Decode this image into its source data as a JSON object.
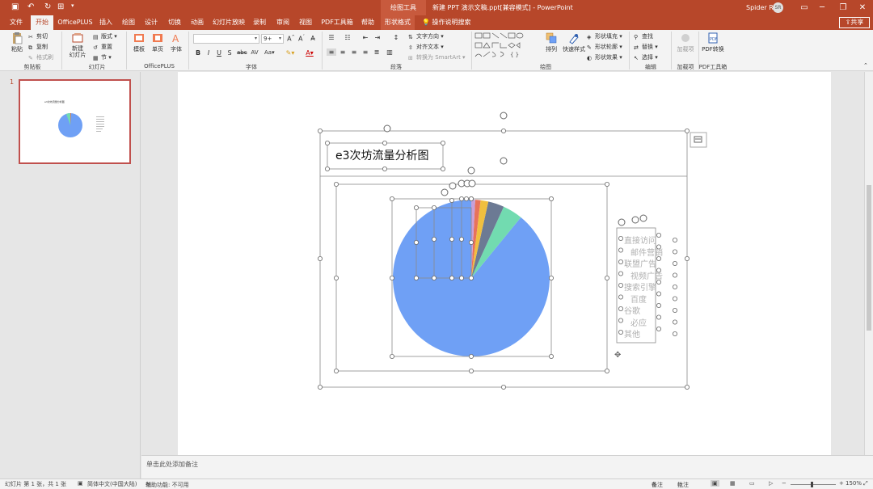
{
  "titlebar": {
    "context_label": "绘图工具",
    "doc_title": "新建 PPT 演示文稿.ppt[兼容模式] - PowerPoint",
    "user": "Spider R",
    "avatar": "SR",
    "qat_icons": [
      "save-icon",
      "undo-icon",
      "redo-icon",
      "slideshow-icon"
    ],
    "window_icons": [
      "ribbon-options-icon",
      "minimize-icon",
      "restore-icon",
      "close-icon"
    ]
  },
  "tabs": [
    {
      "label": "文件"
    },
    {
      "label": "开始"
    },
    {
      "label": "OfficePLUS"
    },
    {
      "label": "插入"
    },
    {
      "label": "绘图"
    },
    {
      "label": "设计"
    },
    {
      "label": "切换"
    },
    {
      "label": "动画"
    },
    {
      "label": "幻灯片放映"
    },
    {
      "label": "录制"
    },
    {
      "label": "审阅"
    },
    {
      "label": "视图"
    },
    {
      "label": "PDF工具箱"
    },
    {
      "label": "帮助"
    },
    {
      "label": "形状格式"
    }
  ],
  "active_tab": "开始",
  "tellme": "操作说明搜索",
  "share": "共享",
  "ribbon": {
    "clipboard": {
      "paste": "粘贴",
      "cut": "剪切",
      "copy": "复制",
      "format_painter": "格式刷",
      "label": "剪贴板"
    },
    "slides": {
      "new_slide": "新建\n幻灯片",
      "layout": "版式",
      "reset": "重置",
      "section": "节",
      "label": "幻灯片"
    },
    "officeplus": {
      "template": "模板",
      "single_page": "单页",
      "font": "字体",
      "label": "OfficePLUS"
    },
    "font": {
      "font_name": "",
      "font_size": "9+",
      "label": "字体"
    },
    "paragraph": {
      "text_direction": "文字方向",
      "align_text": "对齐文本",
      "smartart": "转换为 SmartArt",
      "label": "段落"
    },
    "drawing": {
      "arrange": "排列",
      "quick_styles": "快速样式",
      "shape_fill": "形状填充",
      "shape_outline": "形状轮廓",
      "shape_effects": "形状效果",
      "label": "绘图"
    },
    "editing": {
      "find": "查找",
      "replace": "替换",
      "select": "选择",
      "label": "编辑"
    },
    "addins": {
      "addin": "加载项",
      "label": "加载项"
    },
    "pdf": {
      "convert": "PDF转换",
      "label": "PDF工具箱"
    }
  },
  "thumbnail": {
    "number": "1",
    "title": "e3次坊流量分析图"
  },
  "slide": {
    "title": "e3次坊流量分析图",
    "legend": [
      "直接访问",
      "邮件营销",
      "联盟广告",
      "视频广告",
      "搜索引擎",
      "百度",
      "谷歌",
      "必应",
      "其他"
    ]
  },
  "chart_data": {
    "type": "pie",
    "title": "e3次坊流量分析图",
    "categories": [
      "直接访问",
      "邮件营销",
      "联盟广告",
      "视频广告",
      "搜索引擎",
      "百度",
      "谷歌",
      "必应",
      "其他"
    ],
    "values": [
      89.1,
      4.1,
      3.3,
      1.6,
      1.1,
      0.8,
      0,
      0,
      0
    ],
    "colors": [
      "#6fa0f5",
      "#72dbb0",
      "#6c7a94",
      "#f0bf3f",
      "#e8725a",
      "#c8a0d8",
      "#9ad8e8",
      "#f2a3b8",
      "#b0b0b0"
    ]
  },
  "notes": "单击此处添加备注",
  "status": {
    "slide_info": "幻灯片 第 1 张，共 1 张",
    "language": "简体中文(中国大陆)",
    "accessibility": "辅助功能: 不可用",
    "notes_btn": "备注",
    "comments_btn": "批注",
    "zoom": "150%"
  }
}
